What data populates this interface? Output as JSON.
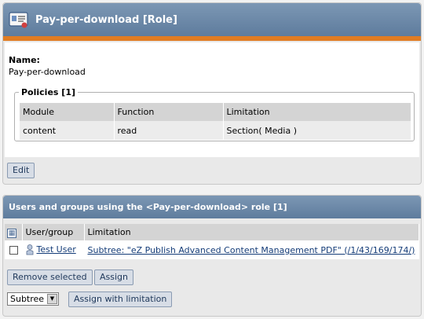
{
  "role": {
    "title": "Pay-per-download [Role]",
    "name_label": "Name:",
    "name_value": "Pay-per-download"
  },
  "policies": {
    "legend": "Policies [1]",
    "columns": [
      "Module",
      "Function",
      "Limitation"
    ],
    "rows": [
      {
        "module": "content",
        "function": "read",
        "limitation": "Section( Media )"
      }
    ],
    "edit_label": "Edit"
  },
  "assignments": {
    "title": "Users and groups using the <Pay-per-download> role [1]",
    "columns": [
      "User/group",
      "Limitation"
    ],
    "rows": [
      {
        "user": "Test User",
        "limitation": "Subtree: \"eZ Publish Advanced Content Management PDF\" (/1/43/169/174/)"
      }
    ],
    "remove_selected_label": "Remove selected",
    "assign_label": "Assign",
    "select_value": "Subtree",
    "assign_with_limitation_label": "Assign with limitation"
  },
  "colors": {
    "header": "#6f8aaa",
    "accent_bar": "#e07c22",
    "link": "#143c78"
  }
}
